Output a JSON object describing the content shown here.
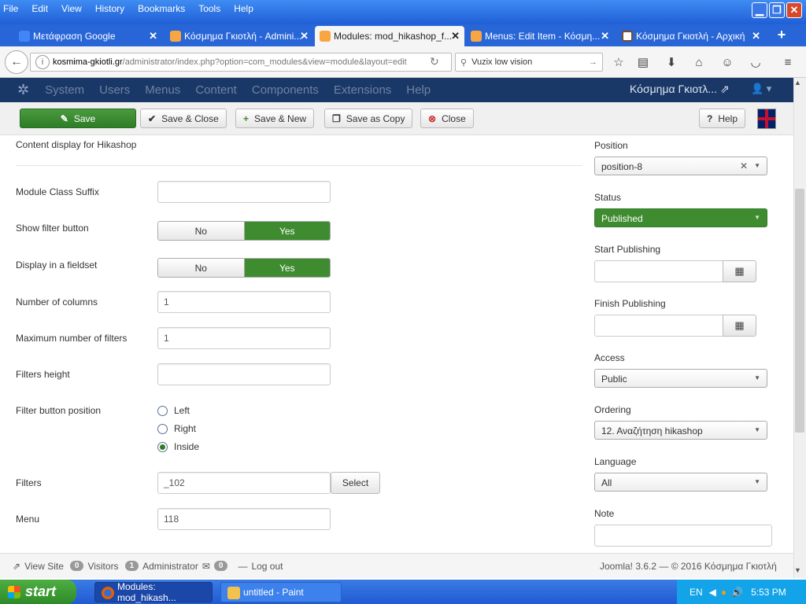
{
  "browser": {
    "menu": [
      "File",
      "Edit",
      "View",
      "History",
      "Bookmarks",
      "Tools",
      "Help"
    ],
    "tabs": [
      {
        "label": "Μετάφραση Google",
        "icon": "google-translate-icon"
      },
      {
        "label": "Κόσμημα Γκιοτλή - Admini...",
        "icon": "joomla-icon"
      },
      {
        "label": "Modules: mod_hikashop_f...",
        "icon": "joomla-icon"
      },
      {
        "label": "Menus: Edit Item - Κόσμη...",
        "icon": "joomla-icon"
      },
      {
        "label": "Κόσμημα Γκιοτλή - Αρχική",
        "icon": "site-icon"
      }
    ],
    "url_host": "kosmima-gkiotli.gr",
    "url_path": "/administrator/index.php?option=com_modules&view=module&layout=edit",
    "search_value": "Vuzix low vision"
  },
  "admin": {
    "menu": [
      "System",
      "Users",
      "Menus",
      "Content",
      "Components",
      "Extensions",
      "Help"
    ],
    "site_name": "Κόσμημα Γκιοτλ...",
    "toolbar": {
      "save": "Save",
      "save_close": "Save & Close",
      "save_new": "Save & New",
      "save_copy": "Save as Copy",
      "close": "Close",
      "help": "Help"
    }
  },
  "form": {
    "heading": "Content display for Hikashop",
    "class_suffix_label": "Module Class Suffix",
    "show_filter_label": "Show filter button",
    "fieldset_label": "Display in a fieldset",
    "no": "No",
    "yes": "Yes",
    "columns_label": "Number of columns",
    "columns_value": "1",
    "max_filters_label": "Maximum number of filters",
    "max_filters_value": "1",
    "height_label": "Filters height",
    "position_label": "Filter button position",
    "radio_left": "Left",
    "radio_right": "Right",
    "radio_inside": "Inside",
    "filters_label": "Filters",
    "filters_value": "_102",
    "select": "Select",
    "menu_label": "Menu",
    "menu_value": "118"
  },
  "side": {
    "position_label": "Position",
    "position_value": "position-8",
    "status_label": "Status",
    "status_value": "Published",
    "start_label": "Start Publishing",
    "finish_label": "Finish Publishing",
    "access_label": "Access",
    "access_value": "Public",
    "ordering_label": "Ordering",
    "ordering_value": "12. Αναζήτηση hikashop",
    "language_label": "Language",
    "language_value": "All",
    "note_label": "Note"
  },
  "footer": {
    "view_site": "View Site",
    "visitors_count": "0",
    "visitors": "Visitors",
    "admin_count": "1",
    "administrator": "Administrator",
    "msg_count": "0",
    "logout": "Log out",
    "version": "Joomla! 3.6.2 — © 2016 Κόσμημα Γκιοτλή"
  },
  "taskbar": {
    "start": "start",
    "item1": "Modules: mod_hikash...",
    "item2": "untitled - Paint",
    "lang": "EN",
    "time": "5:53 PM"
  }
}
